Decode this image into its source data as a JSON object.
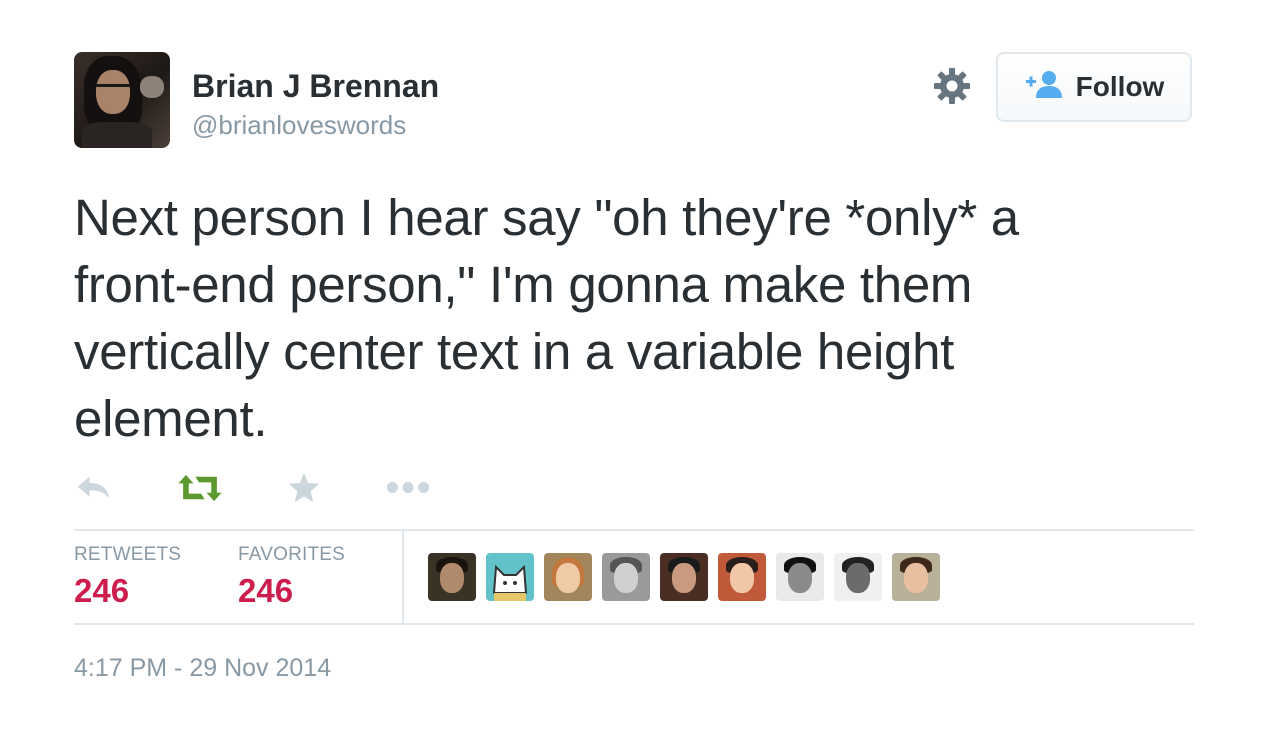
{
  "user": {
    "display_name": "Brian J Brennan",
    "handle": "@brianloveswords"
  },
  "follow_button": {
    "label": "Follow"
  },
  "tweet": {
    "text": "Next person I hear say \"oh they're *only* a\nfront-end person,\" I'm gonna make them\nvertically center text in a variable height\nelement."
  },
  "actions": {
    "reply_icon": "reply-icon",
    "retweet_icon": "retweet-icon",
    "favorite_icon": "star-icon",
    "more_icon": "ellipsis-icon"
  },
  "stats": {
    "retweets_label": "RETWEETS",
    "retweets_count": "246",
    "favorites_label": "FAVORITES",
    "favorites_count": "246"
  },
  "timestamp": "4:17 PM - 29 Nov 2014",
  "colors": {
    "text": "#292f33",
    "muted": "#8899a6",
    "count": "#cc1d4d",
    "retweet_active": "#5c9a2f",
    "follow_icon": "#55acee",
    "border": "#e1e8ed"
  }
}
